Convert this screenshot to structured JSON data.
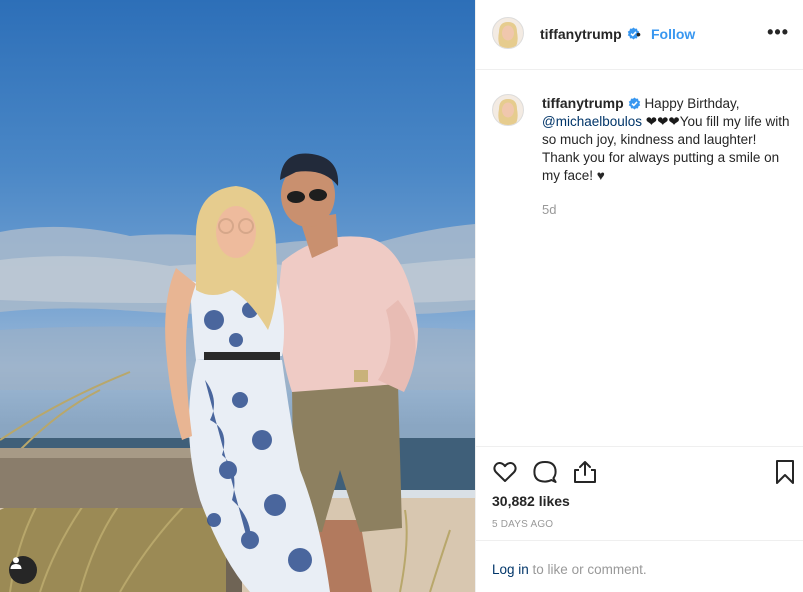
{
  "post": {
    "username": "tiffanytrump",
    "separator": "•",
    "follow_label": "Follow",
    "more_label": "•••",
    "caption": {
      "greeting": "Happy Birthday,",
      "mention": "@michaelboulos",
      "hearts": "❤❤❤",
      "body": "You fill my life with so much joy, kindness and laughter! Thank you for always putting a smile on my face! ♥"
    },
    "time_ago": "5d",
    "likes": "30,882 likes",
    "date": "5 DAYS AGO",
    "login_link": "Log in",
    "login_suffix": " to like or comment."
  },
  "icons": {
    "verified": "verified-badge-icon",
    "like": "heart-icon",
    "comment": "comment-icon",
    "share": "share-icon",
    "save": "bookmark-icon",
    "user_tag": "person-tag-icon"
  },
  "colors": {
    "accent": "#3897f0",
    "text": "#262626",
    "muted": "#999999",
    "link": "#003569",
    "border": "#efefef"
  }
}
